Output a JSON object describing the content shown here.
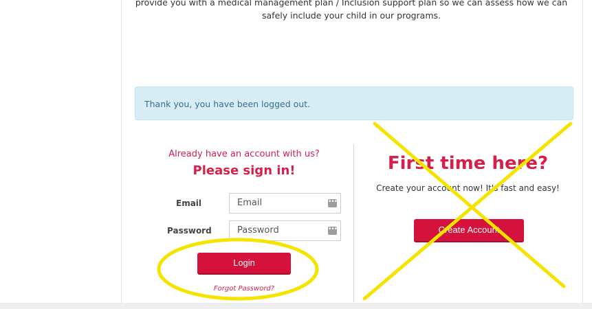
{
  "intro": {
    "line1": "provide you with a medical management plan / Inclusion support plan so we can assess how we can",
    "line2": "safely include your child in our programs."
  },
  "alert": {
    "text": "Thank you, you have been logged out."
  },
  "login": {
    "question": "Already have an account with us?",
    "heading": "Please sign in!",
    "email_label": "Email",
    "email_placeholder": "Email",
    "password_label": "Password",
    "password_placeholder": "Password",
    "login_button": "Login",
    "forgot_link": "Forgot Password?"
  },
  "register": {
    "heading": "First time here?",
    "subtext": "Create your account now! It's fast and easy!",
    "create_button": "Create Account"
  },
  "annotations": {
    "circle_color": "#f5e400",
    "cross_color": "#f5e400"
  },
  "colors": {
    "brand_red": "#d4123c",
    "alert_bg": "#d9edf7"
  }
}
